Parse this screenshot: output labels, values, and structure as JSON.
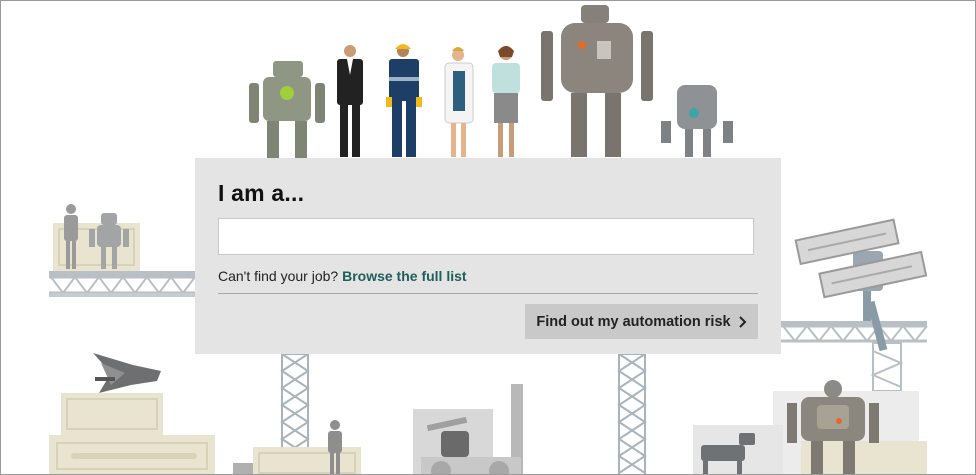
{
  "search": {
    "heading": "I am a...",
    "input_value": "",
    "input_placeholder": "",
    "hint_text": "Can't find your job?",
    "hint_link": "Browse the full list",
    "submit_label": "Find out my automation risk",
    "submit_icon": "chevron-right-icon"
  },
  "illustration": {
    "figures": [
      "robot",
      "businessman",
      "construction-worker",
      "doctor",
      "office-worker",
      "large-robot",
      "small-robot"
    ],
    "colors": {
      "teal_link": "#1e5f5c",
      "panel_bg": "#e4e4e4",
      "button_bg": "#c9c9c9",
      "scaffold": "#a9b3bb",
      "cream": "#e8e4cf"
    }
  }
}
